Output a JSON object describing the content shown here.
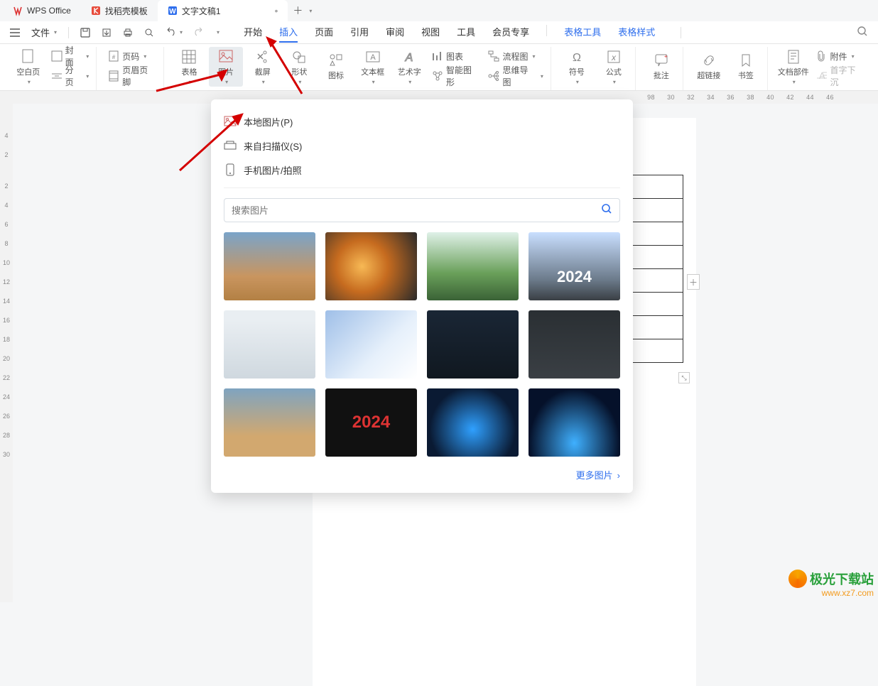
{
  "tabs": {
    "t0": "WPS Office",
    "t1": "找稻壳模板",
    "t2": "文字文稿1"
  },
  "qbar": {
    "file": "文件"
  },
  "menus": {
    "start": "开始",
    "insert": "插入",
    "page": "页面",
    "ref": "引用",
    "review": "审阅",
    "view": "视图",
    "tools": "工具",
    "member": "会员专享",
    "tabletool": "表格工具",
    "tablestyle": "表格样式"
  },
  "ribbon": {
    "blank": "空白页",
    "cover": "封面",
    "pagebreak": "分页",
    "pagenum": "页码",
    "headerfooter": "页眉页脚",
    "table": "表格",
    "picture": "图片",
    "screenshot": "截屏",
    "shape": "形状",
    "icon": "图标",
    "textbox": "文本框",
    "wordart": "艺术字",
    "chart": "图表",
    "smartart": "智能图形",
    "flow": "流程图",
    "mindmap": "思维导图",
    "symbol": "符号",
    "formula": "公式",
    "comment": "批注",
    "hyperlink": "超链接",
    "bookmark": "书签",
    "docpart": "文档部件",
    "dropcap": "首字下沉",
    "attach": "附件"
  },
  "panel": {
    "local": "本地图片(P)",
    "scanner": "来自扫描仪(S)",
    "mobile": "手机图片/拍照",
    "search_ph": "搜索图片",
    "more": "更多图片"
  },
  "ruler_h": [
    "98",
    "30",
    "32",
    "34",
    "36",
    "38",
    "40",
    "42",
    "44",
    "46"
  ],
  "ruler_v": [
    "4",
    "2",
    "",
    "2",
    "4",
    "6",
    "8",
    "10",
    "12",
    "14",
    "16",
    "18",
    "20",
    "22",
    "24",
    "26",
    "28",
    "30"
  ],
  "watermark": {
    "title": "极光下载站",
    "url": "www.xz7.com"
  }
}
